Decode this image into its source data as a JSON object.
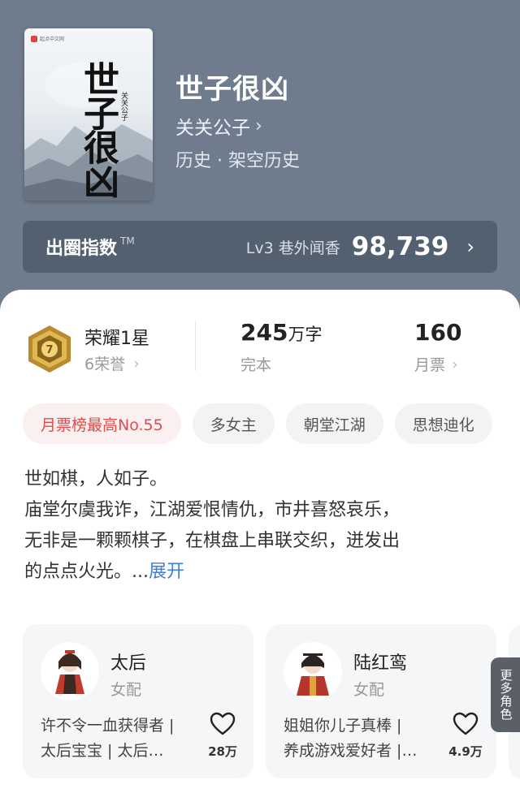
{
  "book": {
    "title": "世子很凶",
    "author": "关关公子",
    "genre": "历史 · 架空历史",
    "cover": {
      "publisher": "起点中文网",
      "title_text": "世子很凶",
      "author_text": "关关公子"
    }
  },
  "circle": {
    "label": "出圈指数",
    "tm": "TM",
    "level_text": "Lv3 巷外闻香",
    "score": "98,739"
  },
  "stats": {
    "honor_title": "荣耀1星",
    "honor_sub": "6荣誉",
    "medal_number": "7",
    "words_num": "245",
    "words_unit": "万字",
    "words_status": "完本",
    "tickets_num": "160",
    "tickets_label": "月票"
  },
  "tags": [
    "月票榜最高No.55",
    "多女主",
    "朝堂江湖",
    "思想迪化"
  ],
  "description": {
    "line1": "世如棋，人如子。",
    "line2": "庙堂尔虞我诈，江湖爱恨情仇，市井喜怒哀乐，",
    "line3": "无非是一颗颗棋子，在棋盘上串联交织，迸发出",
    "line4": "的点点火光。...",
    "expand": "展开"
  },
  "characters": [
    {
      "name": "太后",
      "role": "女配",
      "desc1": "许不令一血获得者 |",
      "desc2": "太后宝宝 | 太后…",
      "likes": "28万"
    },
    {
      "name": "陆红鸾",
      "role": "女配",
      "desc1": "姐姐你儿子真棒 |",
      "desc2": "养成游戏爱好者 |…",
      "likes": "4.9万"
    }
  ],
  "more_roles": "更多角色",
  "colors": {
    "accent_blue": "#3f7fd8",
    "hot_tag_red": "#e04b4b",
    "header_bg": "#6e7c8e"
  }
}
